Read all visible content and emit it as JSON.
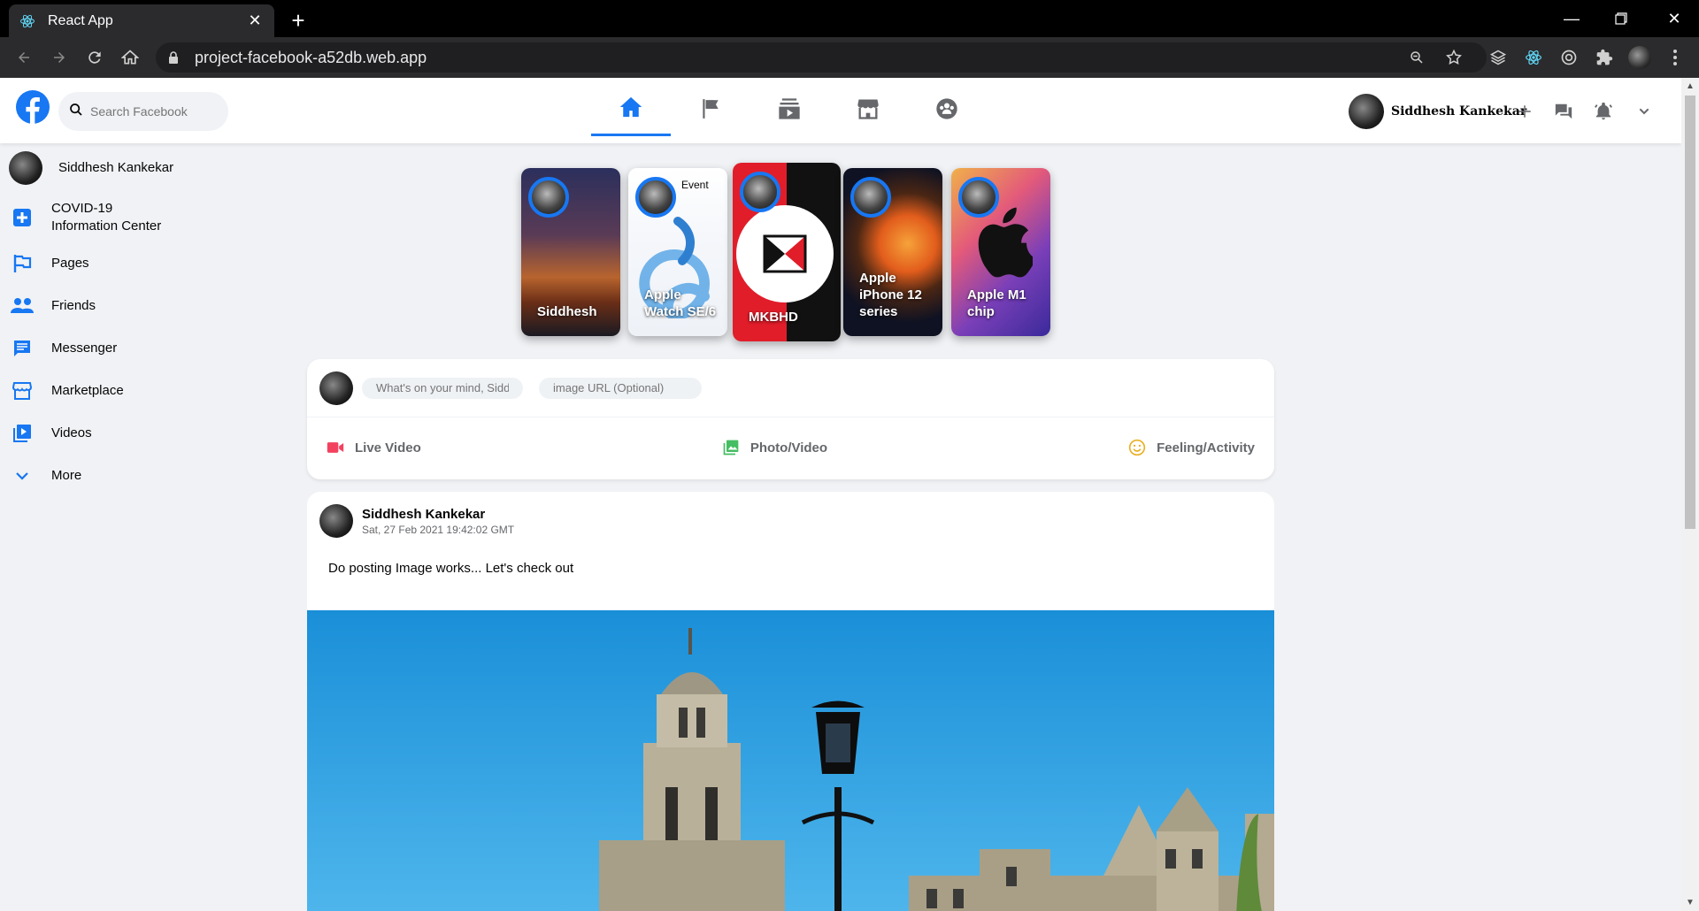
{
  "browser": {
    "tab_title": "React App",
    "url": "project-facebook-a52db.web.app"
  },
  "header": {
    "search_placeholder": "Search Facebook",
    "user_name": "Siddhesh Kankekar"
  },
  "sidebar": {
    "items": [
      {
        "label": "Siddhesh Kankekar",
        "icon": "avatar"
      },
      {
        "label": "COVID-19 Information Center",
        "icon": "plus-square-icon"
      },
      {
        "label": "Pages",
        "icon": "flag-icon"
      },
      {
        "label": "Friends",
        "icon": "people-icon"
      },
      {
        "label": "Messenger",
        "icon": "chat-icon"
      },
      {
        "label": "Marketplace",
        "icon": "store-icon"
      },
      {
        "label": "Videos",
        "icon": "video-library-icon"
      },
      {
        "label": "More",
        "icon": "chevron-down-icon"
      }
    ]
  },
  "stories": [
    {
      "title": "Siddhesh"
    },
    {
      "title": "Apple Watch SE/6",
      "badge": "Event"
    },
    {
      "title": "MKBHD"
    },
    {
      "title": "Apple iPhone 12 series"
    },
    {
      "title": "Apple M1 chip"
    }
  ],
  "composer": {
    "post_placeholder": "What's on your mind, Siddhesh?",
    "image_placeholder": "image URL (Optional)",
    "options": [
      {
        "label": "Live Video",
        "color": "#f3425f"
      },
      {
        "label": "Photo/Video",
        "color": "#45bd62"
      },
      {
        "label": "Feeling/Activity",
        "color": "#eab026"
      }
    ]
  },
  "post": {
    "author": "Siddhesh Kankekar",
    "timestamp": "Sat, 27 Feb 2021 19:42:02 GMT",
    "message": "Do posting Image works... Let's check out"
  },
  "colors": {
    "brand": "#1877f2",
    "background": "#f0f2f5"
  }
}
